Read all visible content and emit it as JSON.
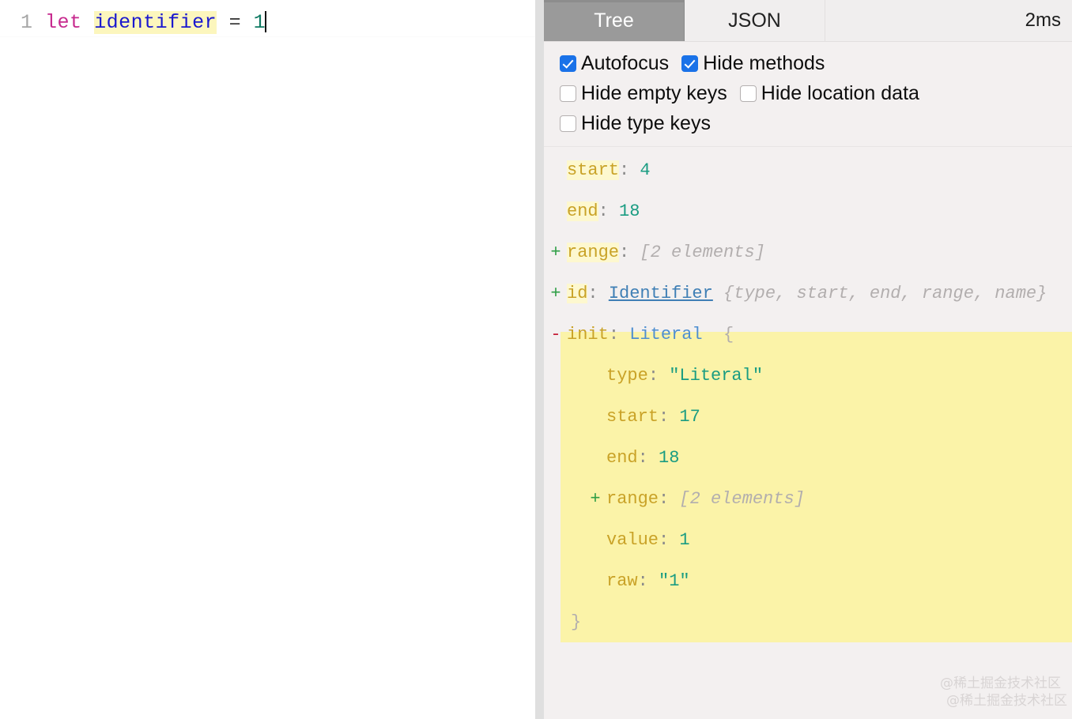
{
  "editor": {
    "line_number": "1",
    "tokens": {
      "keyword": "let",
      "identifier": "identifier",
      "operator": "=",
      "number": "1"
    },
    "full_text": "let identifier = 1"
  },
  "inspector": {
    "tabs": [
      {
        "label": "Tree",
        "active": true
      },
      {
        "label": "JSON",
        "active": false
      }
    ],
    "timing": "2ms",
    "options": [
      {
        "label": "Autofocus",
        "checked": true
      },
      {
        "label": "Hide methods",
        "checked": true
      },
      {
        "label": "Hide empty keys",
        "checked": false
      },
      {
        "label": "Hide location data",
        "checked": false
      },
      {
        "label": "Hide type keys",
        "checked": false
      }
    ],
    "tree": {
      "start_key": "start",
      "start_value": "4",
      "end_key": "end",
      "end_value": "18",
      "range_toggle": "+",
      "range_key": "range",
      "range_value": "[2 elements]",
      "id_toggle": "+",
      "id_key": "id",
      "id_type": "Identifier",
      "id_preview": "{type, start, end, range, name}",
      "init_toggle": "-",
      "init_key": "init",
      "init_type": "Literal",
      "init_open_brace": "{",
      "init_children": {
        "type_key": "type",
        "type_value": "\"Literal\"",
        "start_key": "start",
        "start_value": "17",
        "end_key": "end",
        "end_value": "18",
        "range_toggle": "+",
        "range_key": "range",
        "range_value": "[2 elements]",
        "value_key": "value",
        "value_value": "1",
        "raw_key": "raw",
        "raw_value": "\"1\""
      },
      "init_close_brace": "}"
    }
  },
  "watermark": {
    "line1": "@稀土掘金技术社区",
    "line2": "@稀土掘金技术社区"
  },
  "colors": {
    "accent_checkbox": "#1a72e8",
    "active_tab_bg": "#9a9a9a",
    "key": "#c9a227",
    "value": "#1a9c82",
    "type_link": "#3f7fb5",
    "highlight": "#fbf3a8",
    "editor_highlight": "#fcf6bd",
    "expand_plus": "#2f9e46",
    "collapse_minus": "#c41c35"
  }
}
